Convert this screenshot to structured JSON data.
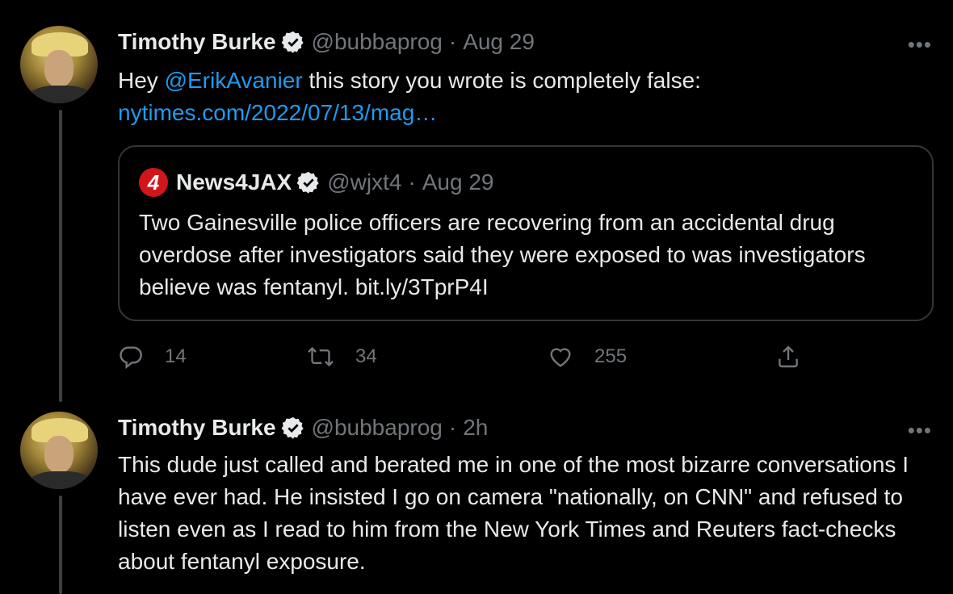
{
  "tweets": [
    {
      "author_name": "Timothy Burke",
      "handle": "@bubbaprog",
      "separator": "·",
      "time": "Aug 29",
      "more": "•••",
      "text_pre": "Hey ",
      "mention": "@ErikAvanier",
      "text_post": " this story you wrote is completely false:",
      "url": "nytimes.com/2022/07/13/mag…",
      "quote": {
        "logo_text": "4",
        "author_name": "News4JAX",
        "handle": "@wjxt4",
        "separator": "·",
        "time": "Aug 29",
        "text": "Two Gainesville police officers are recovering from an accidental drug overdose after investigators said they were exposed to was investigators believe was fentanyl. bit.ly/3TprP4I"
      },
      "actions": {
        "replies": "14",
        "retweets": "34",
        "likes": "255"
      }
    },
    {
      "author_name": "Timothy Burke",
      "handle": "@bubbaprog",
      "separator": "·",
      "time": "2h",
      "more": "•••",
      "text": "This dude just called and berated me in one of the most bizarre conversations I have ever had. He insisted I go on camera \"nationally, on CNN\" and refused to listen even as I read to him from the New York Times and Reuters fact-checks about fentanyl exposure."
    }
  ],
  "icons": {
    "reply": "reply-icon",
    "retweet": "retweet-icon",
    "like": "heart-icon",
    "share": "share-icon",
    "verified": "verified-badge-icon",
    "more": "more-icon"
  },
  "colors": {
    "background": "#000000",
    "text": "#e7e9ea",
    "muted": "#71767b",
    "link": "#1d9bf0",
    "border": "#333639"
  }
}
